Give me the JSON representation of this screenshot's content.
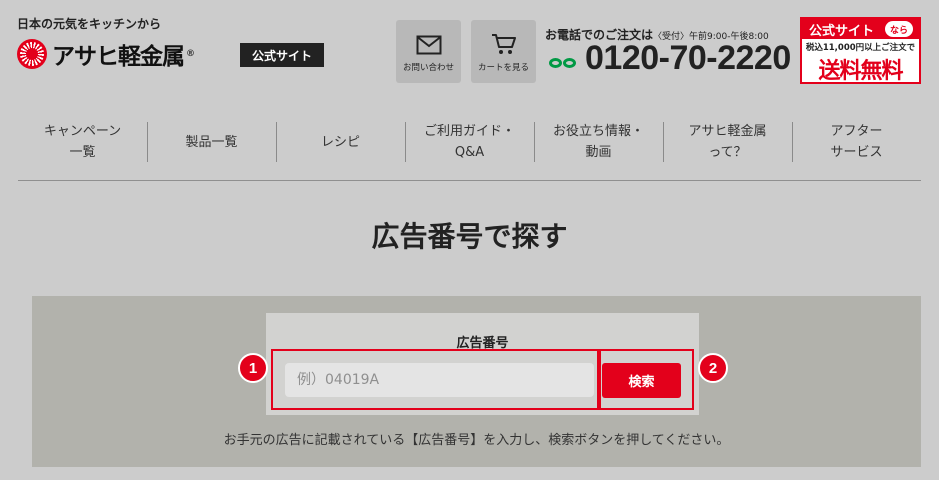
{
  "header": {
    "tagline": "日本の元気をキッチンから",
    "logo_text": "アサヒ軽金属",
    "logo_reg": "®",
    "official_badge": "公式サイト",
    "buttons": [
      {
        "label": "お問い合わせ",
        "icon": "mail-icon"
      },
      {
        "label": "カートを見る",
        "icon": "cart-icon"
      }
    ],
    "phone": {
      "note": "お電話でのご注文は",
      "hours": "〈受付〉午前9:00-午後8:00",
      "number": "0120-70-2220",
      "icon": "freedial-icon"
    },
    "free_shipping": {
      "top": "公式サイト",
      "top_badge": "なら",
      "condition": "税込11,000円以上ご注文で",
      "headline": "送料無料"
    }
  },
  "nav": {
    "items": [
      {
        "label": "キャンペーン\n一覧"
      },
      {
        "label": "製品一覧"
      },
      {
        "label": "レシピ"
      },
      {
        "label": "ご利用ガイド・\nQ&A"
      },
      {
        "label": "お役立ち情報・\n動画"
      },
      {
        "label": "アサヒ軽金属\nって？"
      },
      {
        "label": "アフター\nサービス"
      }
    ]
  },
  "page": {
    "title": "広告番号で探す"
  },
  "search": {
    "label": "広告番号",
    "placeholder": "例）04019A",
    "value": "",
    "button_label": "検索",
    "hint": "お手元の広告に記載されている【広告番号】を入力し、検索ボタンを押してください。"
  },
  "annotations": {
    "marker_1": "1",
    "marker_2": "2"
  },
  "colors": {
    "accent": "#e3001b",
    "page_bg": "#cccccc",
    "panel_bg": "#b2b2ac",
    "freedial": "#009944"
  }
}
